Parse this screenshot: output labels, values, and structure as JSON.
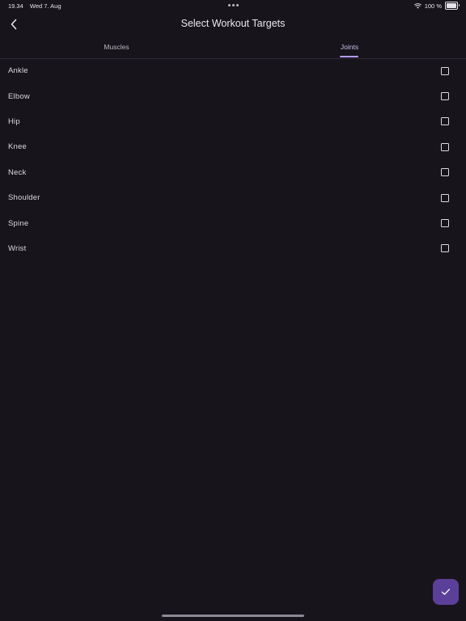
{
  "status_bar": {
    "time": "19.34",
    "date": "Wed 7. Aug",
    "battery": "100 %",
    "battery_level": 1.0,
    "icons": [
      "more-dots-icon",
      "wifi-icon",
      "battery-icon"
    ]
  },
  "header": {
    "title": "Select Workout Targets",
    "back_icon": "chevron-left-icon"
  },
  "tabs": [
    {
      "label": "Muscles",
      "selected": false
    },
    {
      "label": "Joints",
      "selected": true
    }
  ],
  "joints": [
    {
      "label": "Ankle",
      "checked": false
    },
    {
      "label": "Elbow",
      "checked": false
    },
    {
      "label": "Hip",
      "checked": false
    },
    {
      "label": "Knee",
      "checked": false
    },
    {
      "label": "Neck",
      "checked": false
    },
    {
      "label": "Shoulder",
      "checked": false
    },
    {
      "label": "Spine",
      "checked": false
    },
    {
      "label": "Wrist",
      "checked": false
    }
  ],
  "confirm": {
    "icon": "checkmark-icon"
  },
  "colors": {
    "background": "#17141b",
    "accent": "#5b3f99",
    "tab_indicator": "#b79bf5"
  }
}
